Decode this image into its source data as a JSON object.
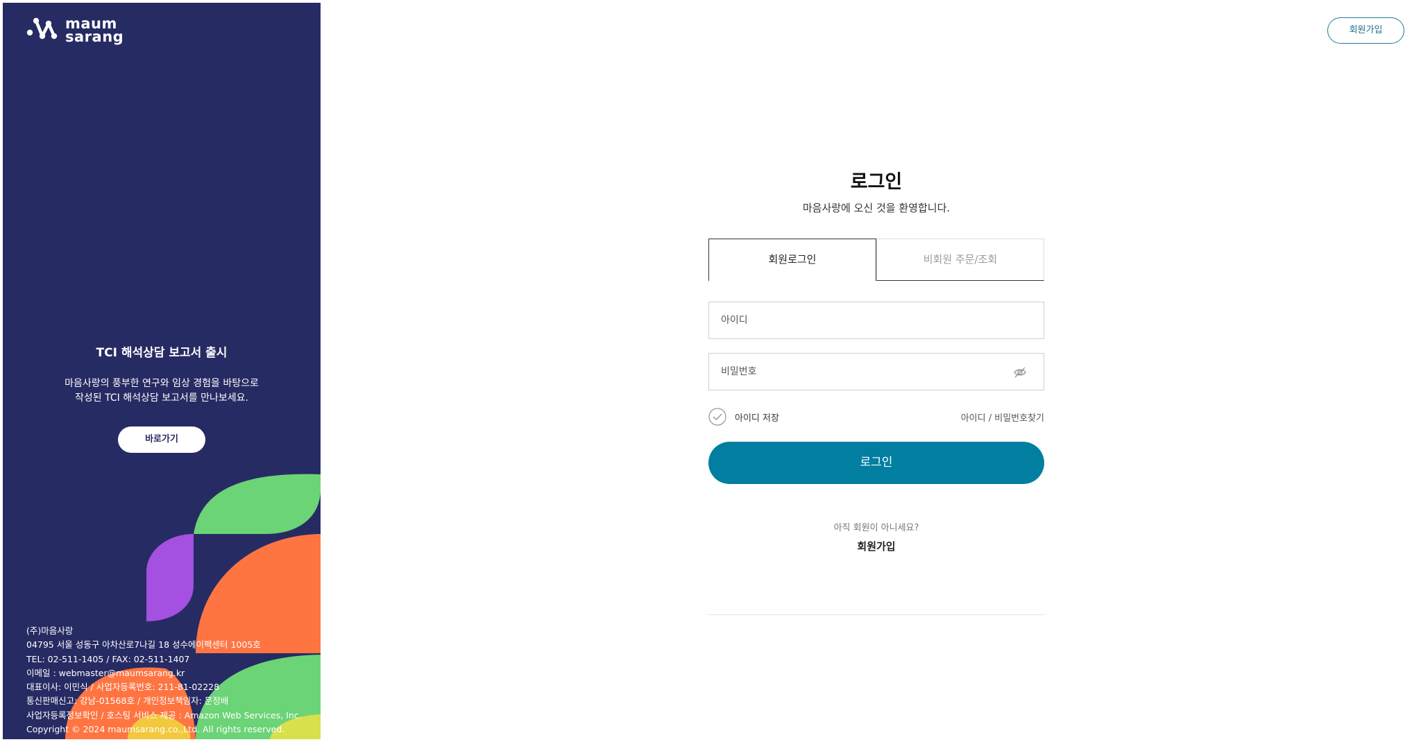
{
  "brand": {
    "line1": "maum",
    "line2": "sarang"
  },
  "colors": {
    "panel": "#272b63",
    "accent": "#027ea0",
    "green": "#6bd476",
    "orange": "#ff7542",
    "purple": "#a450e0"
  },
  "promo": {
    "title": "TCI 해석상담 보고서 출시",
    "desc_line1": "마음사랑의 풍부한 연구와 임상 경험을 바탕으로",
    "desc_line2": "작성된 TCI 해석상담 보고서를 만나보세요.",
    "button": "바로가기"
  },
  "footer": {
    "lines": [
      "(주)마음사랑",
      "04795 서울 성동구 아차산로7나길 18 성수에이팩센터 1005호",
      "TEL: 02-511-1405 / FAX: 02-511-1407",
      "이메일 : webmaster@maumsarang.kr",
      "대표이사: 이민식 / 사업자등록번호: 211-81-02228",
      "통신판매신고: 강남-01568호 / 개인정보책임자: 문정배",
      "사업자등록정보확인 / 호스팅 서비스 제공 : Amazon Web Services, Inc.",
      "Copyright © 2024 maumsarang.co.,Ltd. All rights reserved."
    ]
  },
  "header": {
    "signup": "회원가입"
  },
  "login": {
    "title": "로그인",
    "subtitle": "마음사랑에 오신 것을 환영합니다.",
    "tabs": [
      "회원로그인",
      "비회원 주문/조회"
    ],
    "id_placeholder": "아이디",
    "pw_placeholder": "비밀번호",
    "remember": "아이디 저장",
    "find": "아이디 / 비밀번호찾기",
    "submit": "로그인",
    "join_question": "아직 회원이 아니세요?",
    "join_link": "회원가입"
  }
}
